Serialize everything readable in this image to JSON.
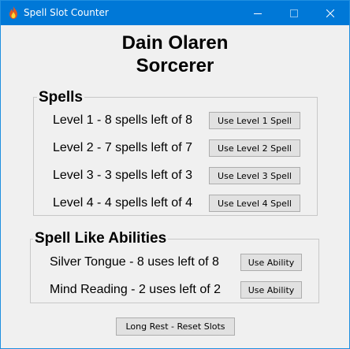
{
  "window": {
    "title": "Spell Slot Counter",
    "icon": "flame-icon",
    "controls": [
      "minimize-icon",
      "maximize-icon",
      "close-icon"
    ]
  },
  "character": {
    "name": "Dain Olaren",
    "class": "Sorcerer"
  },
  "spells": {
    "heading": "Spells",
    "rows": [
      {
        "label": "Level 1 - 8 spells left of 8",
        "button": "Use Level 1 Spell"
      },
      {
        "label": "Level 2 - 7 spells left of 7",
        "button": "Use Level 2 Spell"
      },
      {
        "label": "Level 3 - 3 spells left of 3",
        "button": "Use Level 3 Spell"
      },
      {
        "label": "Level 4 - 4 spells left of 4",
        "button": "Use Level 4 Spell"
      }
    ]
  },
  "abilities": {
    "heading": "Spell Like Abilities",
    "rows": [
      {
        "label": "Silver Tongue - 8 uses left of 8",
        "button": "Use Ability"
      },
      {
        "label": "Mind Reading - 2 uses left of 2",
        "button": "Use Ability"
      }
    ]
  },
  "footer": {
    "reset_button": "Long Rest - Reset Slots"
  },
  "colors": {
    "titlebar": "#0078d7",
    "background": "#f0f0f0",
    "button_face": "#e1e1e1",
    "button_border": "#adadad"
  }
}
